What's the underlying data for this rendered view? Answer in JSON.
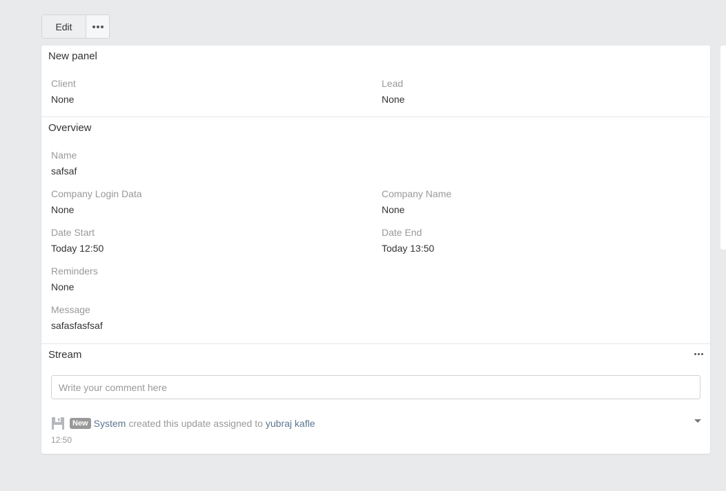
{
  "toolbar": {
    "edit_label": "Edit",
    "more_icon": "ellipsis-icon"
  },
  "new_panel": {
    "title": "New panel",
    "fields": [
      {
        "label": "Client",
        "value": "None"
      },
      {
        "label": "Lead",
        "value": "None"
      }
    ]
  },
  "overview": {
    "title": "Overview",
    "name": {
      "label": "Name",
      "value": "safsaf"
    },
    "company_login": {
      "label": "Company Login Data",
      "value": "None"
    },
    "company_name": {
      "label": "Company Name",
      "value": "None"
    },
    "date_start": {
      "label": "Date Start",
      "value": "Today 12:50"
    },
    "date_end": {
      "label": "Date End",
      "value": "Today 13:50"
    },
    "reminders": {
      "label": "Reminders",
      "value": "None"
    },
    "message": {
      "label": "Message",
      "value": "safasfasfsaf"
    }
  },
  "stream": {
    "title": "Stream",
    "comment_placeholder": "Write your comment here",
    "note": {
      "icon": "save-icon",
      "badge": "New",
      "actor": "System",
      "text": "created this update assigned to",
      "assignee": "yubraj kafle",
      "time": "12:50"
    }
  }
}
